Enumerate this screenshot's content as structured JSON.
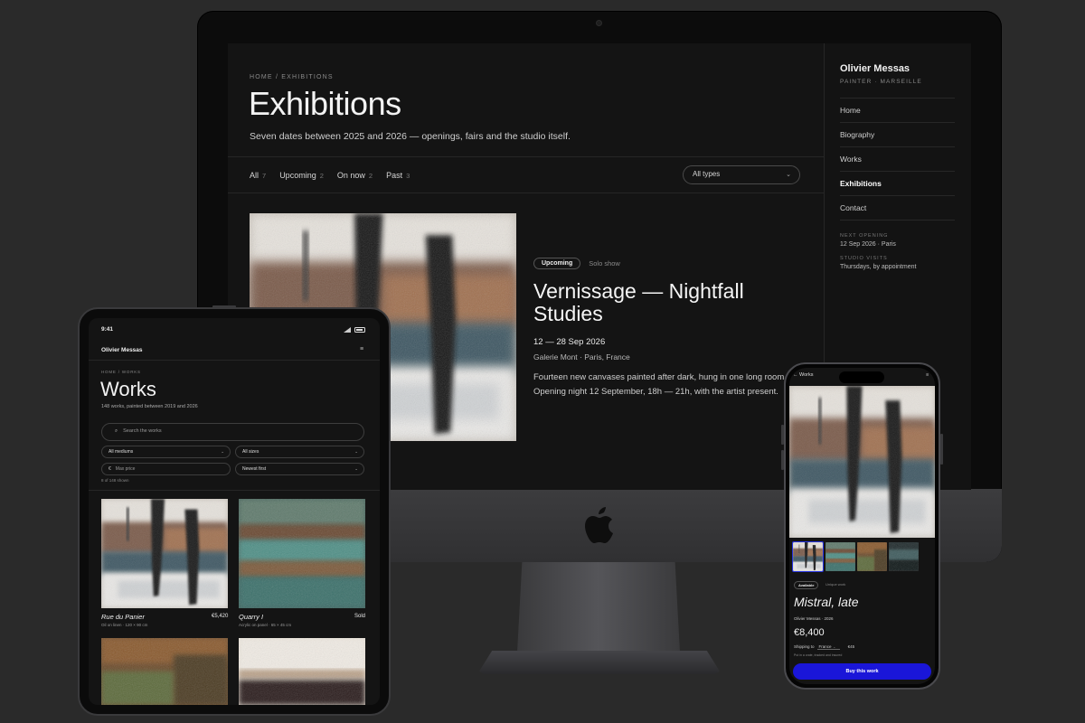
{
  "desktop": {
    "breadcrumb": "HOME / EXHIBITIONS",
    "title": "Exhibitions",
    "subtitle": "Seven dates between 2025 and 2026 — openings, fairs and the studio itself.",
    "filters": [
      {
        "label": "All",
        "count": "7"
      },
      {
        "label": "Upcoming",
        "count": "2"
      },
      {
        "label": "On now",
        "count": "2"
      },
      {
        "label": "Past",
        "count": "3"
      }
    ],
    "type_select": "All types",
    "exhibition": {
      "badge": "Upcoming",
      "kind": "Solo show",
      "title": "Vernissage — Nightfall Studies",
      "dates": "12 — 28 Sep 2026",
      "venue": "Galerie Mont · Paris, France",
      "description": "Fourteen new canvases painted after dark, hung in one long room. Opening night 12 September, 18h — 21h, with the artist present."
    },
    "sidebar": {
      "artist": "Olivier Messas",
      "role": "PAINTER · MARSEILLE",
      "nav": [
        "Home",
        "Biography",
        "Works",
        "Exhibitions",
        "Contact"
      ],
      "active": "Exhibitions",
      "next_opening_label": "NEXT OPENING",
      "next_opening_value": "12 Sep 2026 · Paris",
      "studio_label": "STUDIO VISITS",
      "studio_value": "Thursdays, by appointment"
    }
  },
  "tablet": {
    "time": "9:41",
    "brand": "Olivier Messas",
    "menu_icon": "≡",
    "breadcrumb": "HOME / WORKS",
    "title": "Works",
    "subtitle": "148 works, painted between 2019 and 2026",
    "search_placeholder": "Search the works",
    "medium_select": "All mediums",
    "size_select": "All sizes",
    "price_placeholder": "Max price",
    "currency": "€",
    "sort_select": "Newest first",
    "shown": "8 of 148 shown",
    "works": [
      {
        "title": "Rue du Panier",
        "detail": "Oil on linen · 120 × 90 cm",
        "price": "€5,420"
      },
      {
        "title": "Quarry I",
        "detail": "Acrylic on panel · 65 × 45 cm",
        "price": "Sold"
      }
    ]
  },
  "phone": {
    "back": "← Works",
    "menu_icon": "≡",
    "badge": "Available",
    "badge_sub": "Unique work",
    "title": "Mistral, late",
    "artist": "Olivier Messas · 2026",
    "price": "€8,400",
    "shipping_label": "Shipping to",
    "shipping_country": "France",
    "shipping_fee": "€45",
    "shipping_note": "Put in a crate, tracked and insured",
    "buy_label": "Buy this work"
  },
  "colors": {
    "background": "#2a2a2a",
    "screen": "#141414",
    "accent_button": "#1a16d8"
  }
}
